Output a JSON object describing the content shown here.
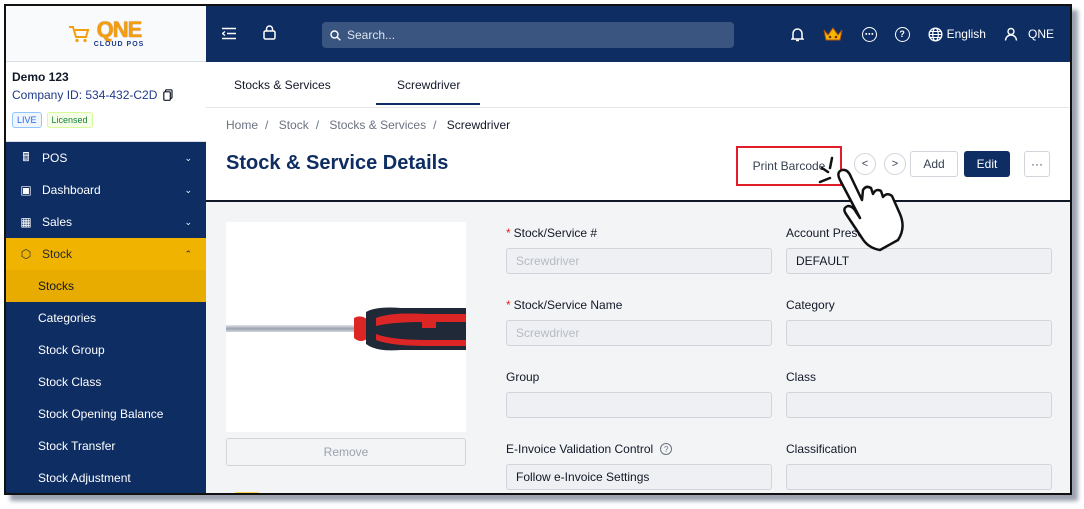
{
  "brand": {
    "logo_main": "QNE",
    "logo_sub": "CLOUD POS"
  },
  "company": {
    "name": "Demo 123",
    "id_text": "Company ID: 534-432-C2D",
    "badge_live": "LIVE",
    "badge_license": "Licensed"
  },
  "sidebar": {
    "items": [
      {
        "label": "POS",
        "icon": "pos-icon"
      },
      {
        "label": "Dashboard",
        "icon": "dashboard-icon"
      },
      {
        "label": "Sales",
        "icon": "sales-icon"
      },
      {
        "label": "Stock",
        "icon": "stock-box-icon"
      }
    ],
    "sub_items": [
      "Stocks",
      "Categories",
      "Stock Group",
      "Stock Class",
      "Stock Opening Balance",
      "Stock Transfer",
      "Stock Adjustment"
    ]
  },
  "topbar": {
    "search_placeholder": "Search...",
    "language": "English",
    "user": "QNE"
  },
  "tabs": [
    "Stocks & Services",
    "Screwdriver"
  ],
  "breadcrumb": [
    "Home",
    "Stock",
    "Stocks & Services",
    "Screwdriver"
  ],
  "page_title": "Stock & Service Details",
  "actions": {
    "print_barcode": "Print Barcode",
    "add": "Add",
    "edit": "Edit",
    "more": "···"
  },
  "image_panel": {
    "remove": "Remove"
  },
  "form": {
    "stock_no_label": "Stock/Service #",
    "stock_no_value": "Screwdriver",
    "account_preset_label": "Account Preset",
    "account_preset_value": "DEFAULT",
    "stock_name_label": "Stock/Service Name",
    "stock_name_value": "Screwdriver",
    "category_label": "Category",
    "category_value": "",
    "group_label": "Group",
    "group_value": "",
    "class_label": "Class",
    "class_value": "",
    "einvoice_label": "E-Invoice Validation Control",
    "einvoice_value": "Follow e-Invoice Settings",
    "classification_label": "Classification",
    "classification_value": ""
  },
  "colors": {
    "navy": "#0d2d63",
    "accent": "#f0b400",
    "highlight": "#e11d2a"
  }
}
